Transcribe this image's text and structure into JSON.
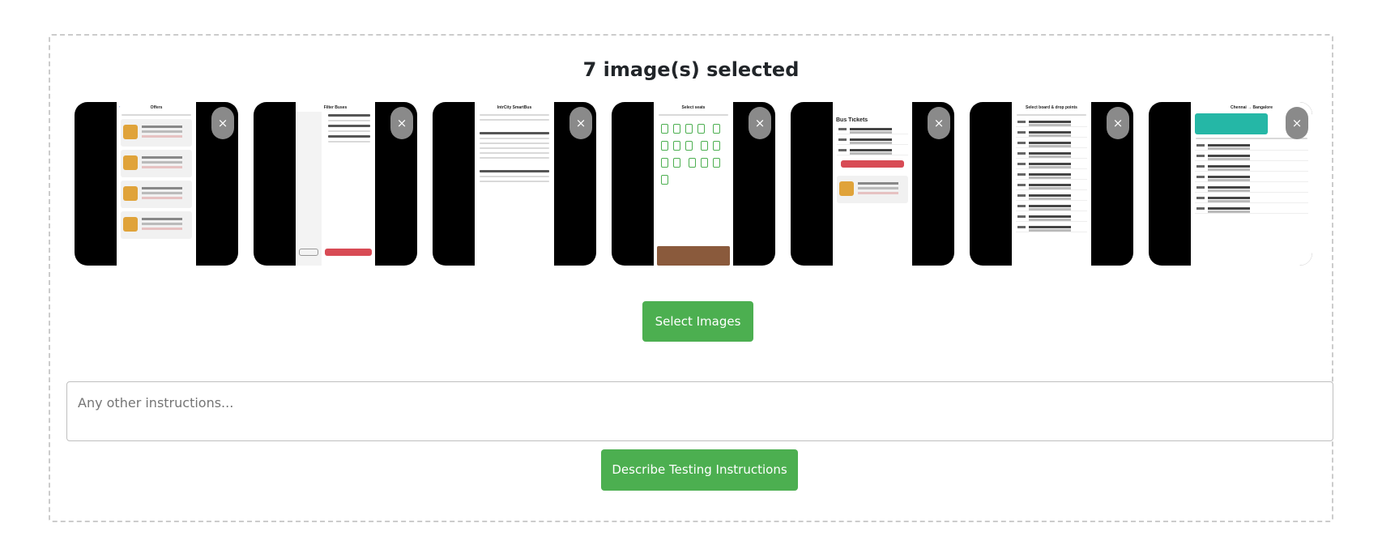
{
  "upload": {
    "count_label": "7 image(s) selected",
    "remove_glyph": "×",
    "select_button_label": "Select Images",
    "instructions_placeholder": "Any other instructions...",
    "describe_button_label": "Describe Testing Instructions"
  },
  "thumbnails": [
    {
      "screen_title": "Offers"
    },
    {
      "screen_title": "Filter Buses"
    },
    {
      "screen_title": "IntrCity SmartBus"
    },
    {
      "screen_title": "Select seats"
    },
    {
      "screen_title": "Bus Tickets"
    },
    {
      "screen_title": "Select board & drop points"
    },
    {
      "screen_title": "Chennai → Bangalore"
    }
  ],
  "colors": {
    "primary_button": "#4caf50",
    "close_button": "#8a8a8a",
    "dropzone_border": "#cccccc"
  }
}
